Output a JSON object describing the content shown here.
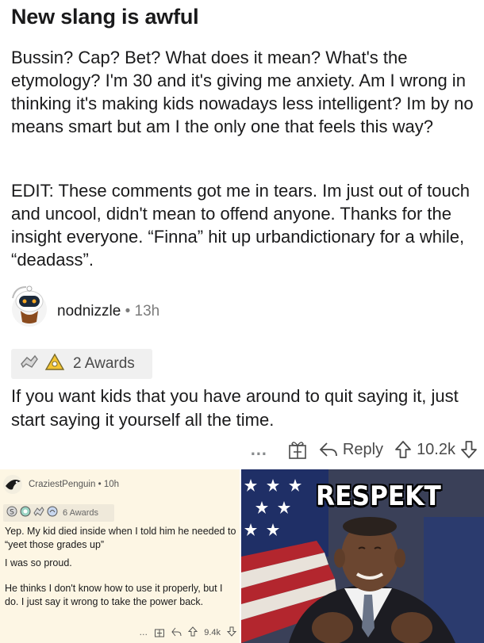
{
  "post": {
    "title": "New slang is awful",
    "body_paragraphs": [
      "Bussin? Cap? Bet? What does it mean? What's the etymology? I'm 30 and it's giving me anxiety. Am I wrong in thinking it's making kids nowadays less intelligent? Im by no means smart but am I the only one that feels this way?",
      "EDIT: These comments got me in tears. Im just out of touch and uncool, didn't mean to offend anyone. Thanks for the insight everyone. “Finna” hit up urbandictionary for a while, “deadass”."
    ]
  },
  "comment": {
    "author": "nodnizzle",
    "separator": "•",
    "age": "13h",
    "awards_label": "2 Awards",
    "text": "If you want kids that you have around to quit saying it, just start saying it yourself all the time.",
    "actions": {
      "more": "…",
      "reply_label": "Reply",
      "score": "10.2k"
    }
  },
  "inner_comment": {
    "author": "CraziestPenguin",
    "separator": "•",
    "age": "10h",
    "awards_label": "6 Awards",
    "paragraphs": [
      "Yep. My kid died inside when I told him he needed to “yeet those grades up”",
      "I was so proud.",
      "He thinks I don't know how to use it properly, but I do. I just say it wrong to take the power back."
    ],
    "actions": {
      "more": "…",
      "score": "9.4k"
    }
  },
  "meme": {
    "caption": "RESPEKT"
  },
  "icons": [
    "snoo-avatar-icon",
    "award-icon",
    "gift-icon",
    "reply-arrow-icon",
    "upvote-icon",
    "downvote-icon"
  ],
  "colors": {
    "text": "#1a1a1b",
    "muted": "#7c7c7c",
    "pill_bg": "#f0f0f0",
    "inner_bg": "#fdf6e4"
  }
}
